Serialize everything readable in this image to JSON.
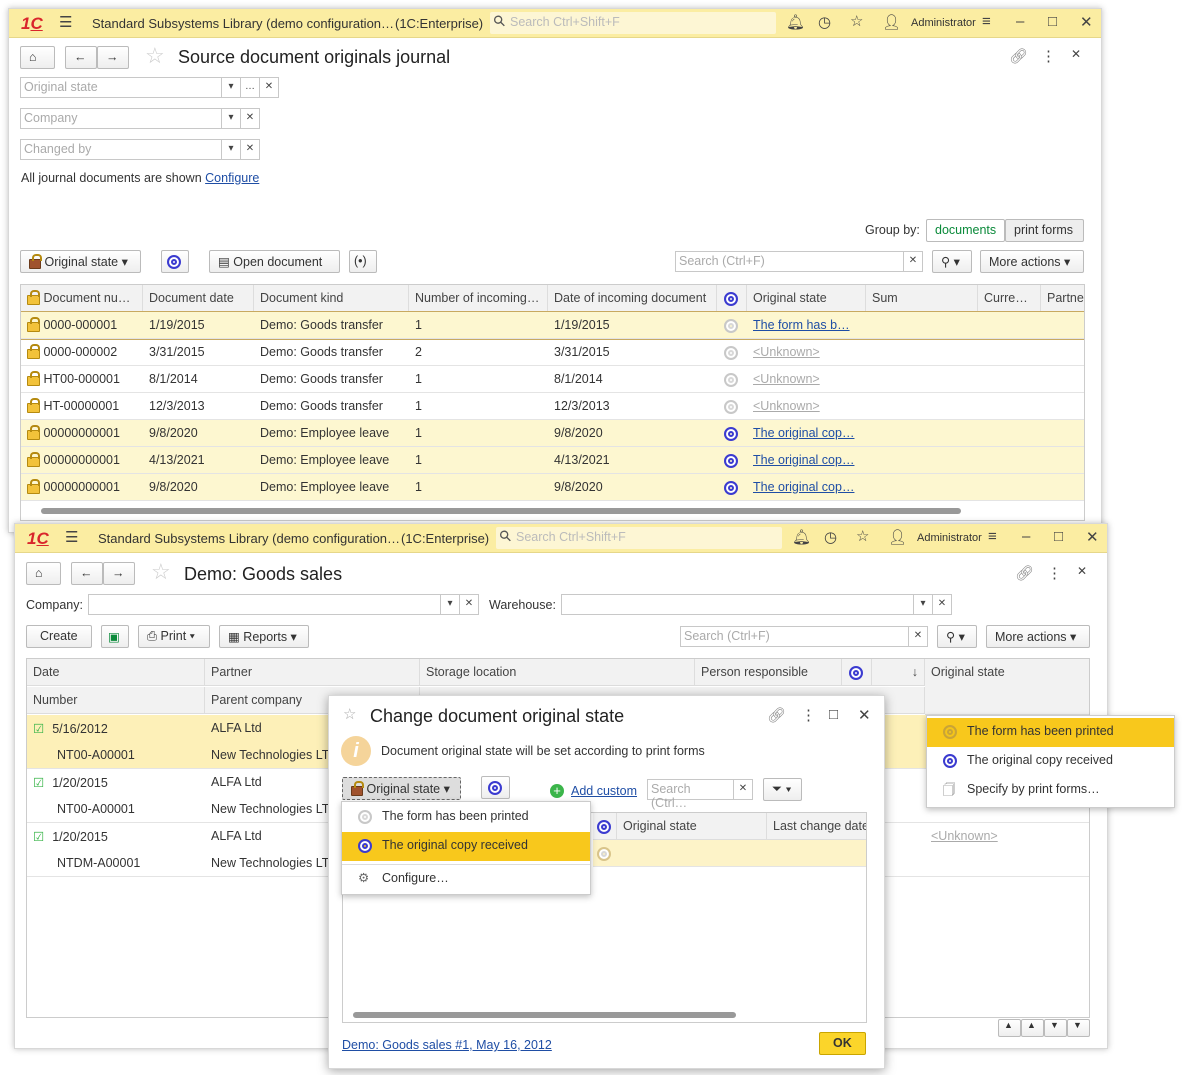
{
  "app": {
    "logo": "1С",
    "title": "Standard Subsystems Library (demo configuration…",
    "platform": "(1C:Enterprise)",
    "search_placeholder": "Search Ctrl+Shift+F",
    "user": "Administrator"
  },
  "journal": {
    "title": "Source document originals journal",
    "filters": [
      {
        "placeholder": "Original state"
      },
      {
        "placeholder": "Company"
      },
      {
        "placeholder": "Changed by"
      }
    ],
    "info_text": "All journal documents are shown",
    "configure_link": "Configure",
    "group_by_label": "Group by:",
    "group_by_options": [
      "documents",
      "print forms"
    ],
    "group_by_selected": "documents",
    "toolbar": {
      "original_state": "Original state",
      "open_document": "Open document",
      "search_placeholder": "Search (Ctrl+F)",
      "more_actions": "More actions"
    },
    "columns": [
      "Document nu…",
      "Document date",
      "Document kind",
      "Number of incoming…",
      "Date of incoming document",
      "",
      "Original state",
      "Sum",
      "Curre…",
      "Partne"
    ],
    "rows": [
      {
        "num": "0000-000001",
        "date": "1/19/2015",
        "kind": "Demo: Goods transfer",
        "n": "1",
        "idate": "1/19/2015",
        "stamp": "grey",
        "state": "The form has b…",
        "hl": true
      },
      {
        "num": "0000-000002",
        "date": "3/31/2015",
        "kind": "Demo: Goods transfer",
        "n": "2",
        "idate": "3/31/2015",
        "stamp": "grey",
        "state": "<Unknown>",
        "hl": false
      },
      {
        "num": "HT00-000001",
        "date": "8/1/2014",
        "kind": "Demo: Goods transfer",
        "n": "1",
        "idate": "8/1/2014",
        "stamp": "grey",
        "state": "<Unknown>",
        "hl": false
      },
      {
        "num": "HT-00000001",
        "date": "12/3/2013",
        "kind": "Demo: Goods transfer",
        "n": "1",
        "idate": "12/3/2013",
        "stamp": "grey",
        "state": "<Unknown>",
        "hl": false
      },
      {
        "num": "00000000001",
        "date": "9/8/2020",
        "kind": "Demo: Employee leave",
        "n": "1",
        "idate": "9/8/2020",
        "stamp": "blue",
        "state": "The original cop…",
        "hl": true
      },
      {
        "num": "00000000001",
        "date": "4/13/2021",
        "kind": "Demo: Employee leave",
        "n": "1",
        "idate": "4/13/2021",
        "stamp": "blue",
        "state": "The original cop…",
        "hl": true
      },
      {
        "num": "00000000001",
        "date": "9/8/2020",
        "kind": "Demo: Employee leave",
        "n": "1",
        "idate": "9/8/2020",
        "stamp": "blue",
        "state": "The original cop…",
        "hl": true
      }
    ]
  },
  "sales": {
    "title": "Demo: Goods sales",
    "company_label": "Company:",
    "warehouse_label": "Warehouse:",
    "toolbar": {
      "create": "Create",
      "print": "Print",
      "reports": "Reports",
      "search_placeholder": "Search (Ctrl+F)",
      "more_actions": "More actions"
    },
    "columns_top": [
      "Date",
      "Partner",
      "Storage location",
      "Person responsible",
      "",
      "↓",
      "Original state"
    ],
    "columns_bottom": [
      "Number",
      "Parent company"
    ],
    "rows": [
      {
        "date": "5/16/2012",
        "number": "NT00-A00001",
        "partner": "ALFA Ltd",
        "parent": "New Technologies LTD",
        "hl": true,
        "state": ""
      },
      {
        "date": "1/20/2015",
        "number": "NT00-A00001",
        "partner": "ALFA Ltd",
        "parent": "New Technologies LTD",
        "hl": false,
        "state": ""
      },
      {
        "date": "1/20/2015",
        "number": "NTDM-A00001",
        "partner": "ALFA Ltd",
        "parent": "New Technologies LTD",
        "hl": false,
        "state": "<Unknown>"
      }
    ]
  },
  "state_popup": {
    "items": [
      {
        "label": "The form has been printed",
        "icon": "gold",
        "selected": true
      },
      {
        "label": "The original copy received",
        "icon": "blue",
        "selected": false
      },
      {
        "label": "Specify by print forms…",
        "icon": "doc",
        "selected": false
      }
    ]
  },
  "dialog": {
    "title": "Change document original state",
    "info": "Document original state will be set according to print forms",
    "original_state_btn": "Original state",
    "add_custom": "Add custom",
    "search_placeholder": "Search (Ctrl…",
    "columns": [
      "",
      "Original state",
      "Last change date"
    ],
    "menu": [
      {
        "label": "The form has been printed",
        "icon": "grey",
        "selected": false
      },
      {
        "label": "The original copy received",
        "icon": "blue",
        "selected": true
      },
      {
        "label": "Configure…",
        "icon": "gear",
        "selected": false
      }
    ],
    "footer_link": "Demo: Goods sales #1, May 16, 2012",
    "ok": "OK"
  },
  "colors": {
    "titlebar": "#fbeda2",
    "highlight": "#fdf7d0",
    "selected": "#f8c81c",
    "link": "#1f4ea5",
    "ok_button": "#fbd52a"
  }
}
